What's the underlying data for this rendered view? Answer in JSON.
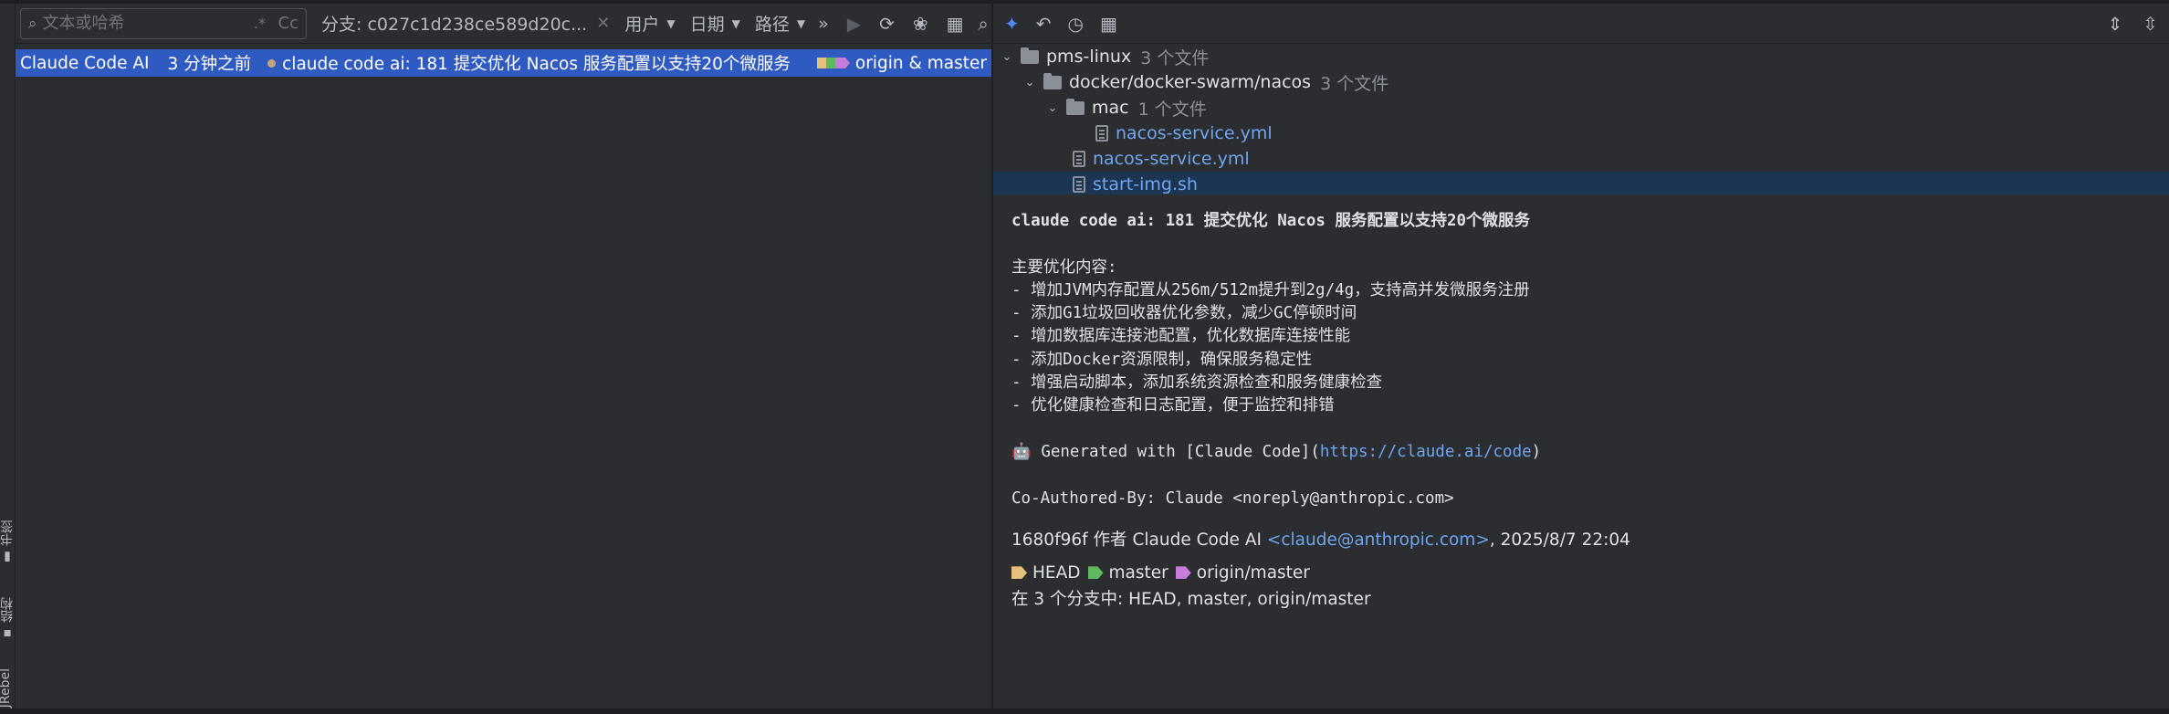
{
  "left_toolbar": {
    "search_placeholder": "文本或哈希",
    "regex_icon": "regex-icon",
    "case_label": "Cc",
    "branch_filter": "分支: c027c1d238ce589d20c...",
    "user_filter": "用户",
    "date_filter": "日期",
    "path_filter": "路径",
    "more": "»"
  },
  "commit_row": {
    "author": "Claude Code AI",
    "time": "3 分钟之前",
    "message": "claude code ai: 181 提交优化 Nacos 服务配置以支持20个微服务",
    "refs": "origin & master"
  },
  "left_strip": {
    "bookmarks": "书签",
    "structure": "结构",
    "jrebel": "JRebel"
  },
  "tree": {
    "root": {
      "name": "pms-linux",
      "count": "3 个文件"
    },
    "dir": {
      "name": "docker/docker-swarm/nacos",
      "count": "3 个文件"
    },
    "subdir": {
      "name": "mac",
      "count": "1 个文件"
    },
    "files": [
      "nacos-service.yml",
      "nacos-service.yml",
      "start-img.sh"
    ]
  },
  "details": {
    "title": "claude code ai: 181 提交优化 Nacos 服务配置以支持20个微服务",
    "section": "主要优化内容:",
    "bullets": [
      "- 增加JVM内存配置从256m/512m提升到2g/4g，支持高并发微服务注册",
      "- 添加G1垃圾回收器优化参数，减少GC停顿时间",
      "- 增加数据库连接池配置，优化数据库连接性能",
      "- 添加Docker资源限制，确保服务稳定性",
      "- 增强启动脚本，添加系统资源检查和服务健康检查",
      "- 优化健康检查和日志配置，便于监控和排错"
    ],
    "generated_prefix": "🤖 Generated with [Claude Code](",
    "generated_link": "https://claude.ai/code",
    "generated_suffix": ")",
    "coauthor": "Co-Authored-By: Claude <noreply@anthropic.com>",
    "hash": "1680f96f",
    "by_label": "作者",
    "author": "Claude Code AI",
    "email": "<claude@anthropic.com>",
    "date": ", 2025/8/7 22:04",
    "refs": [
      "HEAD",
      "master",
      "origin/master"
    ],
    "branches": "在 3 个分支中: HEAD, master, origin/master"
  },
  "colors": {
    "selection": "#2e5ac1",
    "head_tag": "#e5c07b",
    "master_tag": "#5fb95f",
    "origin_tag": "#c77dd9",
    "link": "#6ea6f0"
  }
}
